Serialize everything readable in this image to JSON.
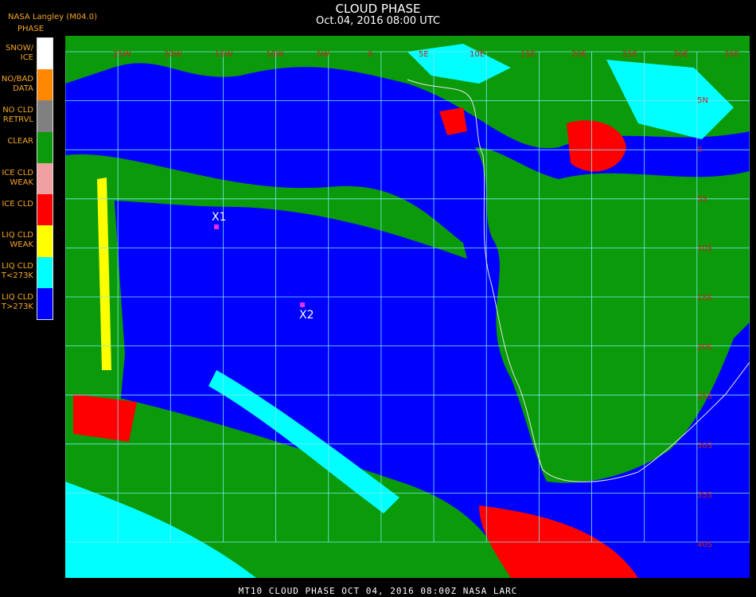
{
  "header": {
    "title": "CLOUD PHASE",
    "timestamp": "Oct.04, 2016 08:00 UTC",
    "credit": "NASA Langley (M04.0)"
  },
  "legend": {
    "title": "PHASE",
    "items": [
      {
        "label": "SNOW/\nICE",
        "color": "#ffffff"
      },
      {
        "label": "NO/BAD\nDATA",
        "color": "#ff8800"
      },
      {
        "label": "NO CLD\nRETRVL",
        "color": "#808080"
      },
      {
        "label": "CLEAR",
        "color": "#0a9a0a"
      },
      {
        "label": "ICE CLD\nWEAK",
        "color": "#f0a0a0"
      },
      {
        "label": "ICE CLD",
        "color": "#ff0000"
      },
      {
        "label": "LIQ CLD\nWEAK",
        "color": "#ffff00"
      },
      {
        "label": "LIQ CLD\nT<273K",
        "color": "#00ffff"
      },
      {
        "label": "LIQ CLD\nT>273K",
        "color": "#0000ff"
      }
    ]
  },
  "map": {
    "colors": {
      "ocean_liquid": "#0000ff",
      "land_clear": "#0a9a0a",
      "grid": "#7fe8f0",
      "coast": "#e6e6e6",
      "lat_label": "#cc2222",
      "marker": "#e030e0"
    },
    "lon_labels": [
      "25W",
      "20W",
      "15W",
      "10W",
      "5W",
      "0",
      "5E",
      "10E",
      "15E",
      "20E",
      "25E",
      "30E",
      "35E"
    ],
    "lat_labels": [
      "5N",
      "0",
      "5S",
      "10S",
      "15S",
      "20S",
      "25S",
      "30S",
      "35S",
      "40S"
    ],
    "markers": [
      "X1",
      "X2"
    ]
  },
  "footer": {
    "text": "MT10  CLOUD PHASE   OCT 04, 2016 08:00Z   NASA LARC"
  }
}
